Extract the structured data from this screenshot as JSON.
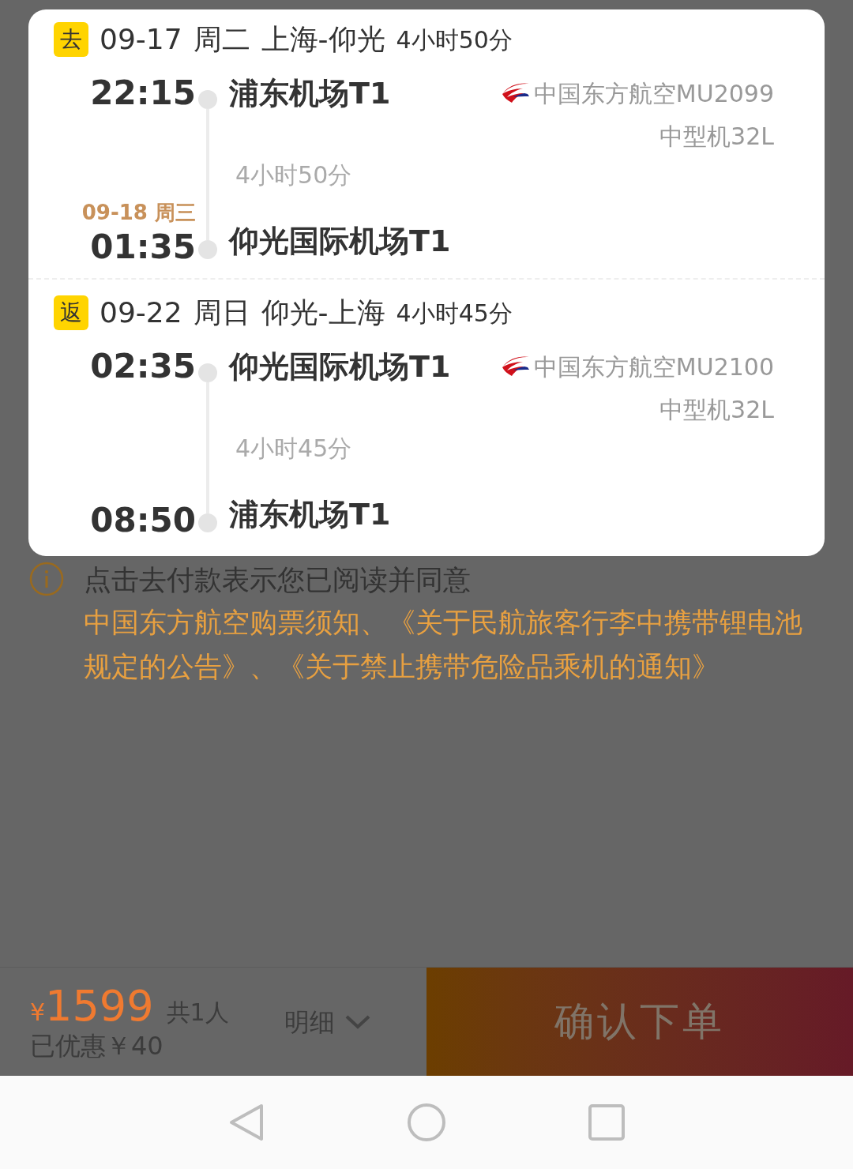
{
  "trips": [
    {
      "badge": "去",
      "date": "09-17",
      "weekday": "周二",
      "route": "上海-仰光",
      "duration": "4小时50分",
      "depart_time": "22:15",
      "depart_airport": "浦东机场T1",
      "airline_flight": "中国东方航空MU2099",
      "aircraft": "中型机32L",
      "flight_duration": "4小时50分",
      "arrive_date": "09-18 周三",
      "arrive_time": "01:35",
      "arrive_airport": "仰光国际机场T1"
    },
    {
      "badge": "返",
      "date": "09-22",
      "weekday": "周日",
      "route": "仰光-上海",
      "duration": "4小时45分",
      "depart_time": "02:35",
      "depart_airport": "仰光国际机场T1",
      "airline_flight": "中国东方航空MU2100",
      "aircraft": "中型机32L",
      "flight_duration": "4小时45分",
      "arrive_time": "08:50",
      "arrive_airport": "浦东机场T1"
    }
  ],
  "notice": {
    "intro": "点击去付款表示您已阅读并同意",
    "links": "中国东方航空购票须知、《关于民航旅客行李中携带锂电池规定的公告》、《关于禁止携带危险品乘机的通知》"
  },
  "bottom_bar": {
    "currency": "¥",
    "price": "1599",
    "passengers": "共1人",
    "discount": "已优惠￥40",
    "details": "明细",
    "confirm": "确认下单"
  }
}
